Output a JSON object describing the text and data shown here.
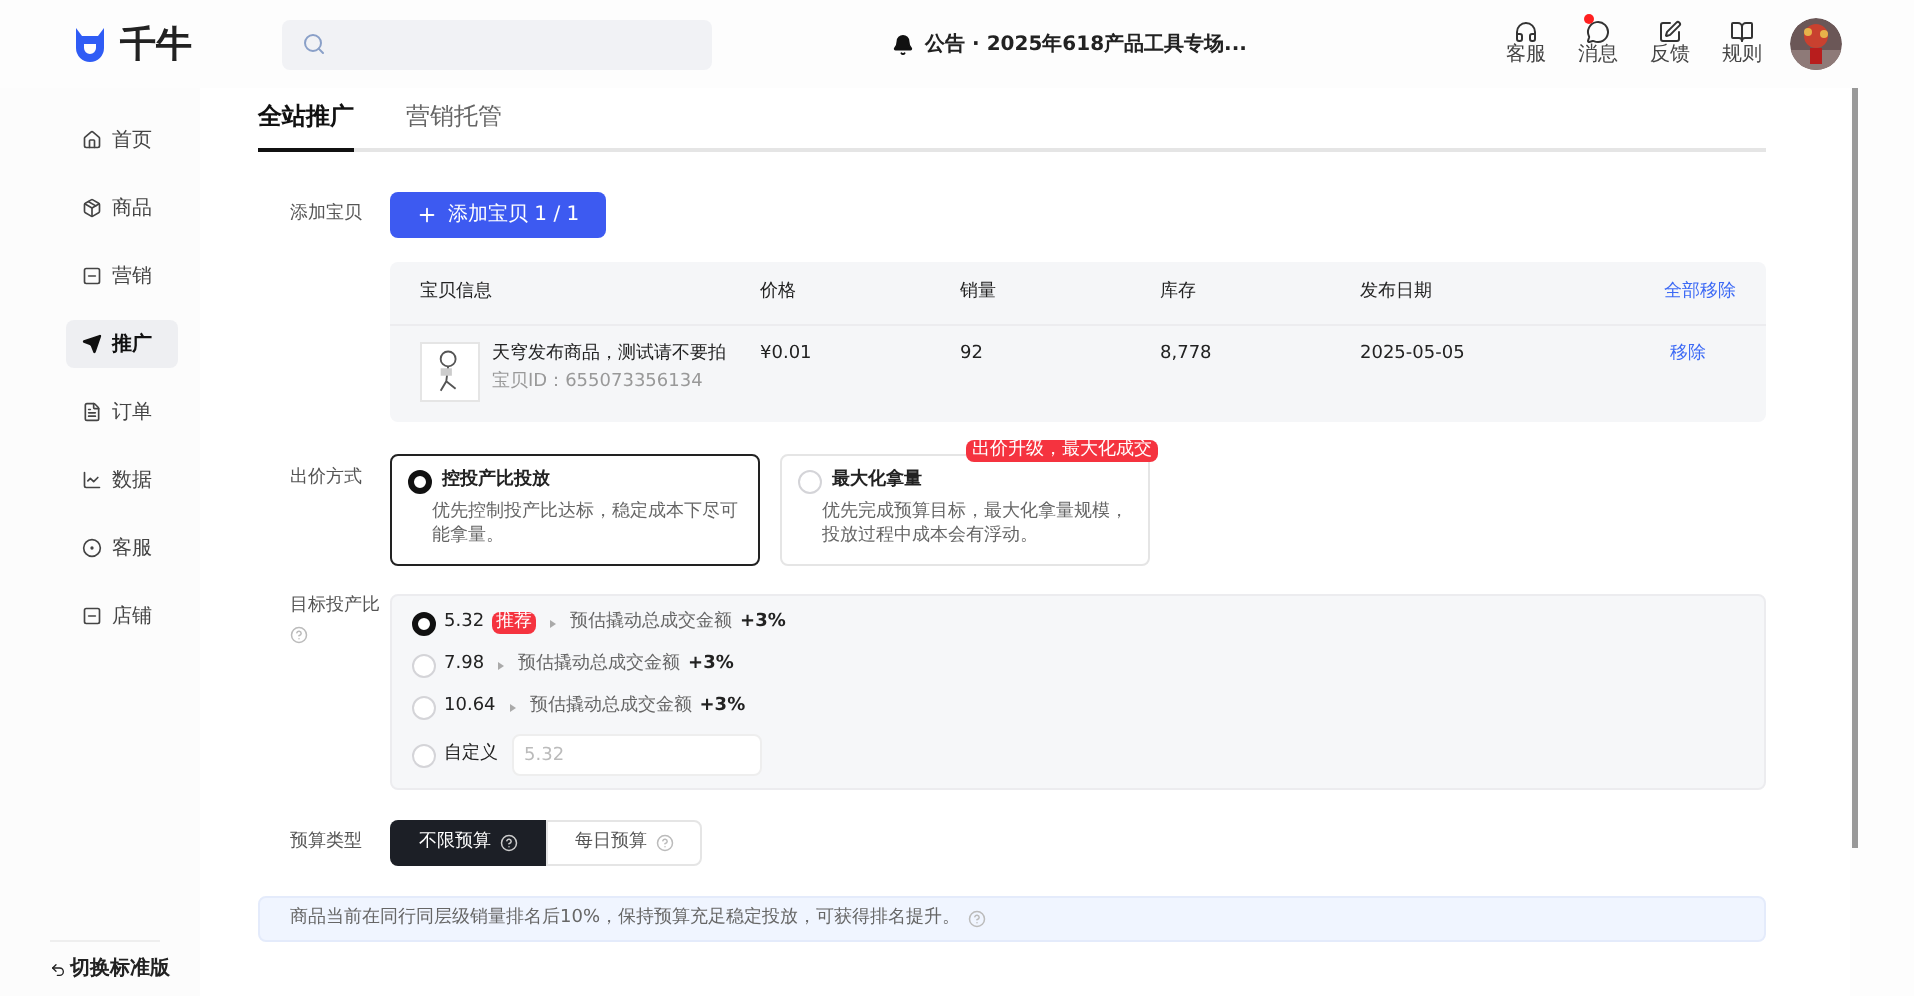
{
  "header": {
    "logo_text": "千牛",
    "notice": "公告 · 2025年618产品工具专场...",
    "actions": [
      {
        "label": "客服",
        "kind": "headset",
        "unread": false
      },
      {
        "label": "消息",
        "kind": "message",
        "unread": true
      },
      {
        "label": "反馈",
        "kind": "edit",
        "unread": false
      },
      {
        "label": "规则",
        "kind": "book",
        "unread": false
      }
    ]
  },
  "sidebar": {
    "items": [
      {
        "label": "首页",
        "kind": "home",
        "selected": false
      },
      {
        "label": "商品",
        "kind": "box",
        "selected": false
      },
      {
        "label": "营销",
        "kind": "square",
        "selected": false
      },
      {
        "label": "推广",
        "kind": "send",
        "selected": true
      },
      {
        "label": "订单",
        "kind": "file",
        "selected": false
      },
      {
        "label": "数据",
        "kind": "chart",
        "selected": false
      },
      {
        "label": "客服",
        "kind": "service",
        "selected": false
      },
      {
        "label": "店铺",
        "kind": "square",
        "selected": false
      }
    ],
    "footer": "切换标准版"
  },
  "tabs": [
    {
      "label": "全站推广",
      "selected": true
    },
    {
      "label": "营销托管",
      "selected": false
    }
  ],
  "add_item": {
    "label": "添加宝贝",
    "button": "添加宝贝 1 / 1"
  },
  "table": {
    "columns": [
      "宝贝信息",
      "价格",
      "销量",
      "库存",
      "发布日期"
    ],
    "action_header": "全部移除",
    "rows": [
      {
        "title": "天穹发布商品，测试请不要拍",
        "id": "宝贝ID：655073356134",
        "price": "¥0.01",
        "sales": "92",
        "stock": "8,778",
        "date": "2025-05-05",
        "action": "移除"
      }
    ]
  },
  "bid": {
    "label": "出价方式",
    "options": [
      {
        "title": "控投产比投放",
        "desc": "优先控制投产比达标，稳定成本下尽可能拿量。",
        "selected": true
      },
      {
        "title": "最大化拿量",
        "desc": "优先完成预算目标，最大化拿量规模，投放过程中成本会有浮动。",
        "selected": false,
        "badge": "出价升级，最大化成交"
      }
    ]
  },
  "target": {
    "label": "目标投产比",
    "options": [
      {
        "kind": "preset",
        "value": "5.32",
        "tag": "推荐",
        "estimate": "预估撬动总成交金额",
        "gain": "+3%",
        "selected": true
      },
      {
        "kind": "preset",
        "value": "7.98",
        "estimate": "预估撬动总成交金额",
        "gain": "+3%",
        "selected": false
      },
      {
        "kind": "preset",
        "value": "10.64",
        "estimate": "预估撬动总成交金额",
        "gain": "+3%",
        "selected": false
      },
      {
        "kind": "custom",
        "label": "自定义",
        "placeholder": "5.32",
        "selected": false
      }
    ]
  },
  "budget": {
    "label": "预算类型",
    "options": [
      {
        "label": "不限预算",
        "selected": true
      },
      {
        "label": "每日预算",
        "selected": false
      }
    ]
  },
  "tip": "商品当前在同行同层级销量排名后10%，保持预算充足稳定投放，可获得排名提升。"
}
